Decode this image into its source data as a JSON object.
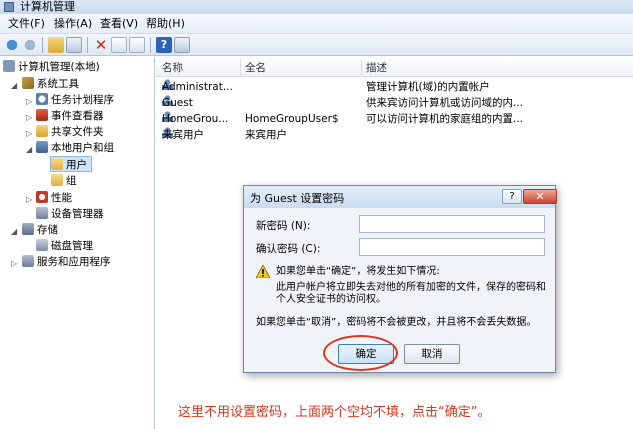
{
  "window": {
    "title": "计算机管理"
  },
  "menu": {
    "items": [
      "文件(F)",
      "操作(A)",
      "查看(V)",
      "帮助(H)"
    ]
  },
  "tree": {
    "items": [
      {
        "label": "计算机管理(本地)"
      },
      {
        "label": "系统工具"
      },
      {
        "label": "任务计划程序"
      },
      {
        "label": "事件查看器"
      },
      {
        "label": "共享文件夹"
      },
      {
        "label": "本地用户和组"
      },
      {
        "label": "用户"
      },
      {
        "label": "组"
      },
      {
        "label": "性能"
      },
      {
        "label": "设备管理器"
      },
      {
        "label": "存储"
      },
      {
        "label": "磁盘管理"
      },
      {
        "label": "服务和应用程序"
      }
    ]
  },
  "list": {
    "columns": [
      "名称",
      "全名",
      "描述"
    ],
    "rows": [
      {
        "name": "Administrat...",
        "fullname": "",
        "desc": "管理计算机(域)的内置帐户"
      },
      {
        "name": "Guest",
        "fullname": "",
        "desc": "供来宾访问计算机或访问域的内..."
      },
      {
        "name": "HomeGrou...",
        "fullname": "HomeGroupUser$",
        "desc": "可以访问计算机的家庭组的内置..."
      },
      {
        "name": "来宾用户",
        "fullname": "来宾用户",
        "desc": ""
      }
    ]
  },
  "dialog": {
    "title": "为 Guest 设置密码",
    "help": "?",
    "close": "✕",
    "new_password_label": "新密码 (N):",
    "confirm_password_label": "确认密码 (C):",
    "new_password_value": "",
    "confirm_password_value": "",
    "warn_line1": "如果您单击“确定”，将发生如下情况:",
    "warn_line2": "此用户帐户将立即失去对他的所有加密的文件，保存的密码和",
    "warn_line3": "个人安全证书的访问权。",
    "cancel_note": "如果您单击“取消”，密码将不会被更改，并且将不会丢失数据。",
    "ok_label": "确定",
    "cancel_label": "取消"
  },
  "annotation": "这里不用设置密码，上面两个空均不填，点击“确定”。",
  "colors": {
    "accent_red": "#d9361e",
    "selection": "#cfe3fb"
  }
}
